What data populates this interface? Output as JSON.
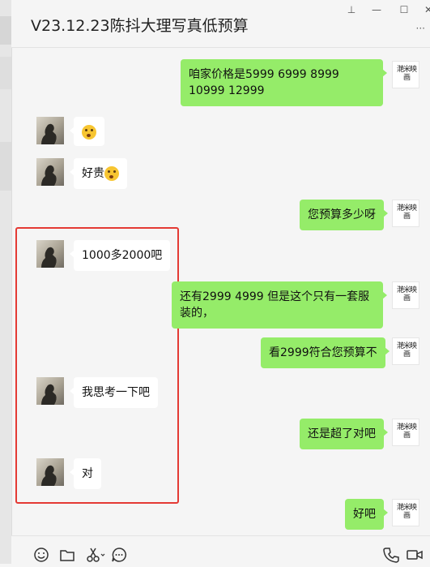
{
  "window": {
    "title": "V23.12.23陈抖大理写真低预算",
    "pin_glyph": "⊥",
    "minimize_glyph": "—",
    "maximize_glyph": "☐",
    "close_glyph": "✕",
    "more_glyph": "···"
  },
  "self_avatar_text": "滟米映画",
  "messages": [
    {
      "sender": "self",
      "text": "咱家价格是5999  6999  8999 10999 12999"
    },
    {
      "sender": "other",
      "text": "",
      "emoji": "surprised-emoji"
    },
    {
      "sender": "other",
      "text": "好贵",
      "emoji": "surprised-emoji"
    },
    {
      "sender": "self",
      "text": "您预算多少呀"
    },
    {
      "sender": "other",
      "text": "1000多2000吧"
    },
    {
      "sender": "self",
      "text": "还有2999 4999 但是这个只有一套服装的，"
    },
    {
      "sender": "self",
      "text": "看2999符合您预算不"
    },
    {
      "sender": "other",
      "text": "我思考一下吧"
    },
    {
      "sender": "self",
      "text": "还是超了对吧"
    },
    {
      "sender": "other",
      "text": "对"
    },
    {
      "sender": "self",
      "text": "好吧"
    }
  ],
  "toolbar": {
    "icons": [
      "emoji-icon",
      "folder-icon",
      "scissors-icon",
      "chat-history-icon",
      "phone-icon",
      "video-call-icon"
    ]
  },
  "colors": {
    "self_bubble": "#95ec69",
    "other_bubble": "#ffffff",
    "highlight": "#e43a34",
    "background": "#f5f5f5"
  }
}
